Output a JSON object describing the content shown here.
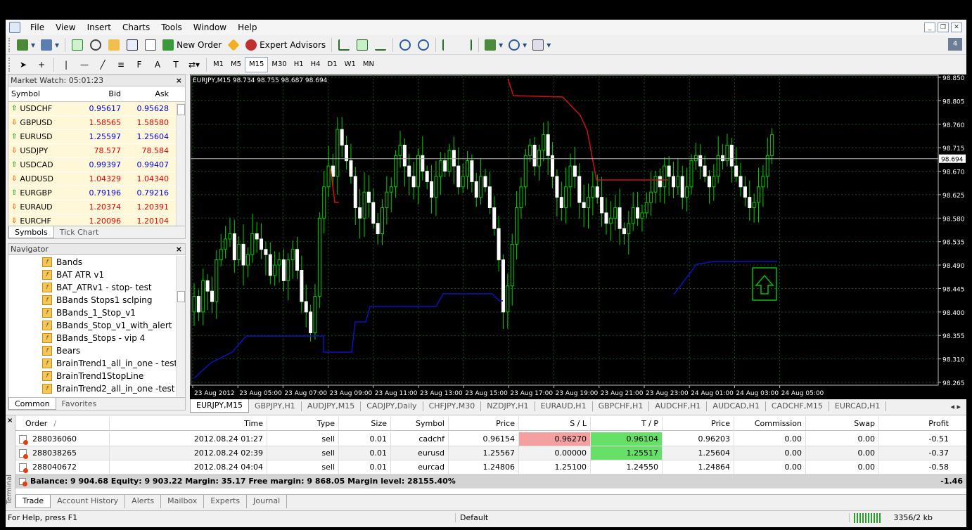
{
  "menu": [
    "File",
    "View",
    "Insert",
    "Charts",
    "Tools",
    "Window",
    "Help"
  ],
  "toolbar": {
    "new_order": "New Order",
    "expert_advisors": "Expert Advisors"
  },
  "timeframes": [
    "M1",
    "M5",
    "M15",
    "M30",
    "H1",
    "H4",
    "D1",
    "W1",
    "MN"
  ],
  "active_timeframe": "M15",
  "market_watch": {
    "title": "Market Watch: 05:01:23",
    "columns": [
      "Symbol",
      "Bid",
      "Ask"
    ],
    "rows": [
      {
        "symbol": "USDCHF",
        "bid": "0.95617",
        "ask": "0.95628",
        "dir": "up"
      },
      {
        "symbol": "GBPUSD",
        "bid": "1.58565",
        "ask": "1.58580",
        "dir": "down"
      },
      {
        "symbol": "EURUSD",
        "bid": "1.25597",
        "ask": "1.25604",
        "dir": "up"
      },
      {
        "symbol": "USDJPY",
        "bid": "78.577",
        "ask": "78.584",
        "dir": "down"
      },
      {
        "symbol": "USDCAD",
        "bid": "0.99397",
        "ask": "0.99407",
        "dir": "up"
      },
      {
        "symbol": "AUDUSD",
        "bid": "1.04329",
        "ask": "1.04340",
        "dir": "down"
      },
      {
        "symbol": "EURGBP",
        "bid": "0.79196",
        "ask": "0.79216",
        "dir": "up"
      },
      {
        "symbol": "EURAUD",
        "bid": "1.20374",
        "ask": "1.20391",
        "dir": "down"
      },
      {
        "symbol": "EURCHF",
        "bid": "1.20096",
        "ask": "1.20104",
        "dir": "down"
      }
    ],
    "tabs": [
      "Symbols",
      "Tick Chart"
    ]
  },
  "navigator": {
    "title": "Navigator",
    "items": [
      "Bands",
      "BAT ATR v1",
      "BAT_ATRv1 - stop- test",
      "BBands Stops1 sclping",
      "BBands_1_Stop_v1",
      "BBands_Stop_v1_with_alert",
      "BBands_Stops - vip 4",
      "Bears",
      "BrainTrend1_all_in_one - test",
      "BrainTrend1StopLine",
      "BrainTrend2_all_in_one -test"
    ],
    "tabs": [
      "Common",
      "Favorites"
    ]
  },
  "chart": {
    "header": "EURJPY,M15  98.734 98.755 98.687 98.694",
    "current_price": "98.694",
    "price_labels": [
      "98.850",
      "98.805",
      "98.760",
      "98.715",
      "98.670",
      "98.625",
      "98.580",
      "98.535",
      "98.490",
      "98.445",
      "98.400",
      "98.355",
      "98.310",
      "98.265"
    ],
    "time_labels": [
      "23 Aug 2012",
      "23 Aug 05:00",
      "23 Aug 07:00",
      "23 Aug 09:00",
      "23 Aug 11:00",
      "23 Aug 13:00",
      "23 Aug 15:00",
      "23 Aug 17:00",
      "23 Aug 19:00",
      "23 Aug 21:00",
      "23 Aug 23:00",
      "24 Aug 01:00",
      "24 Aug 03:00",
      "24 Aug 05:00"
    ]
  },
  "chart_tabs": [
    "EURJPY,M15",
    "GBPJPY,H1",
    "AUDJPY,M15",
    "CADJPY,Daily",
    "CHFJPY,M30",
    "NZDJPY,H1",
    "EURAUD,H1",
    "GBPCHF,H1",
    "AUDCHF,H1",
    "AUDCAD,H1",
    "CADCHF,M15",
    "EURCAD,H1"
  ],
  "terminal": {
    "columns": {
      "order": "Order",
      "sort": "/",
      "time": "Time",
      "type": "Type",
      "size": "Size",
      "symbol": "Symbol",
      "price": "Price",
      "sl": "S / L",
      "tp": "T / P",
      "current": "Price",
      "commission": "Commission",
      "swap": "Swap",
      "profit": "Profit"
    },
    "orders": [
      {
        "order": "288036060",
        "time": "2012.08.24 01:27",
        "type": "sell",
        "size": "0.01",
        "symbol": "cadchf",
        "price": "0.96154",
        "sl": "0.96270",
        "tp": "0.96104",
        "current": "0.96203",
        "commission": "0.00",
        "swap": "0.00",
        "profit": "-0.51"
      },
      {
        "order": "288038265",
        "time": "2012.08.24 02:39",
        "type": "sell",
        "size": "0.01",
        "symbol": "eurusd",
        "price": "1.25567",
        "sl": "0.00000",
        "tp": "1.25517",
        "current": "1.25604",
        "commission": "0.00",
        "swap": "0.00",
        "profit": "-0.37"
      },
      {
        "order": "288040672",
        "time": "2012.08.24 04:04",
        "type": "sell",
        "size": "0.01",
        "symbol": "eurcad",
        "price": "1.24806",
        "sl": "1.25100",
        "tp": "1.24550",
        "current": "1.24864",
        "commission": "0.00",
        "swap": "0.00",
        "profit": "-0.58"
      }
    ],
    "summary": "Balance: 9 904.68  Equity: 9 903.22  Margin: 35.17  Free margin: 9 868.05  Margin level: 28155.40%",
    "summary_profit": "-1.46",
    "tabs": [
      "Trade",
      "Account History",
      "Alerts",
      "Mailbox",
      "Experts",
      "Journal"
    ],
    "side_label": "Terminal"
  },
  "statusbar": {
    "help": "For Help, press F1",
    "profile": "Default",
    "traffic": "3356/2 kb"
  }
}
